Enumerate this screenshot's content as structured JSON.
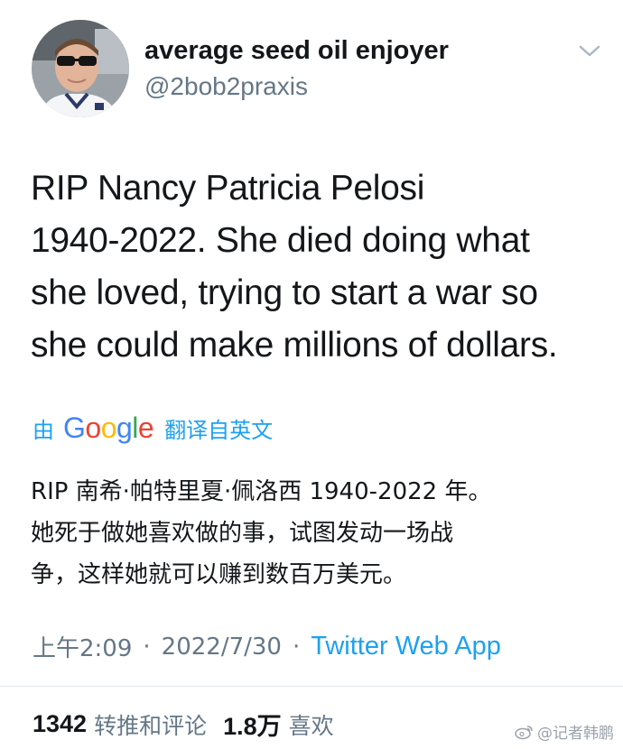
{
  "user": {
    "display_name": "average seed oil enjoyer",
    "handle": "@2bob2praxis",
    "avatar_icon": "avatar-photo"
  },
  "tweet": {
    "lines": [
      "RIP Nancy Patricia Pelosi",
      "1940-2022. She died doing what",
      "she loved, trying to start a war so",
      "she could make millions of dollars."
    ]
  },
  "translation": {
    "by_label": "由",
    "provider_letters": [
      "G",
      "o",
      "o",
      "g",
      "l",
      "e"
    ],
    "from_label": "翻译自英文",
    "lines": [
      "RIP 南希·帕特里夏·佩洛西 1940-2022 年。",
      "她死于做她喜欢做的事，试图发动一场战",
      "争，这样她就可以赚到数百万美元。"
    ]
  },
  "meta": {
    "time": "上午2:09",
    "separator": "·",
    "date": "2022/7/30",
    "source": "Twitter Web App"
  },
  "stats": {
    "retweets_count": "1342",
    "retweets_label": "转推和评论",
    "likes_count": "1.8万",
    "likes_label": "喜欢"
  },
  "watermark": {
    "text": "@记者韩鹏"
  },
  "colors": {
    "link": "#1da1f2",
    "secondary_text": "#657786",
    "primary_text": "#14171a"
  }
}
